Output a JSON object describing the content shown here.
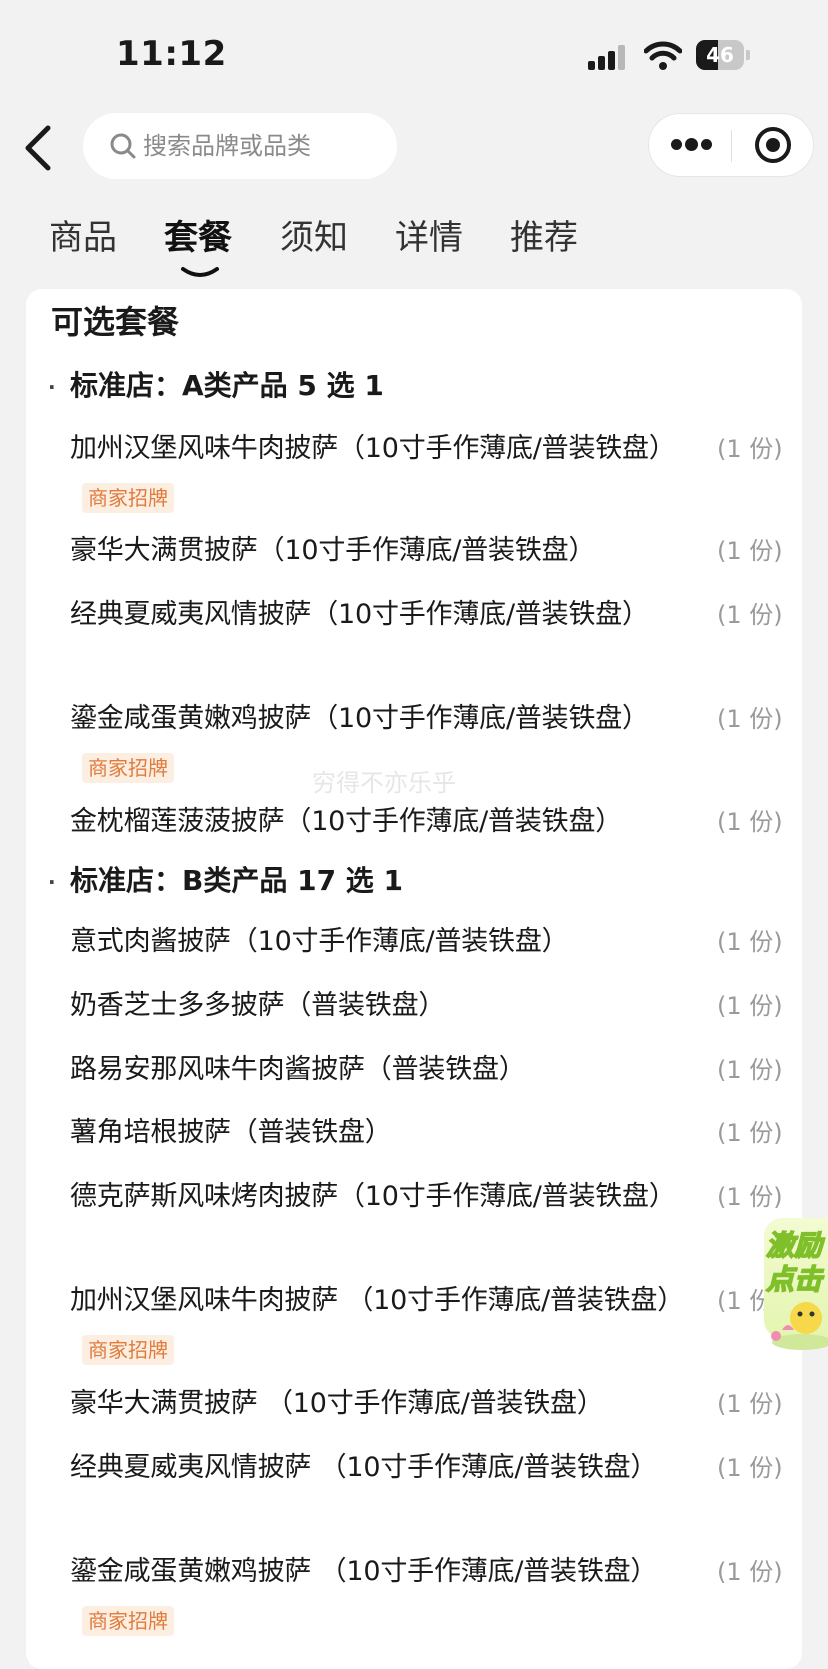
{
  "status_bar": {
    "time": "11:12",
    "battery_level": "46",
    "battery_fraction": 0.46
  },
  "search": {
    "placeholder": "搜索品牌或品类"
  },
  "tabs": [
    {
      "label": "商品",
      "active": false
    },
    {
      "label": "套餐",
      "active": true
    },
    {
      "label": "须知",
      "active": false
    },
    {
      "label": "详情",
      "active": false
    },
    {
      "label": "推荐",
      "active": false
    }
  ],
  "card": {
    "title": "可选套餐"
  },
  "groups": [
    {
      "header": "标准店：A类产品 5 选 1",
      "items": [
        {
          "name": "加州汉堡风味牛肉披萨（10寸手作薄底/普装铁盘）",
          "qty": "(1 份)",
          "tag": "商家招牌"
        },
        {
          "name": "豪华大满贯披萨（10寸手作薄底/普装铁盘）",
          "qty": "(1 份)",
          "tag": ""
        },
        {
          "name": "经典夏威夷风情披萨（10寸手作薄底/普装铁盘）",
          "qty": "(1 份)",
          "tag": ""
        },
        {
          "name": "鎏金咸蛋黄嫩鸡披萨（10寸手作薄底/普装铁盘）",
          "qty": "(1 份)",
          "tag": "商家招牌"
        },
        {
          "name": "金枕榴莲菠菠披萨（10寸手作薄底/普装铁盘）",
          "qty": "(1 份)",
          "tag": ""
        }
      ]
    },
    {
      "header": "标准店：B类产品 17 选 1",
      "items": [
        {
          "name": "意式肉酱披萨（10寸手作薄底/普装铁盘）",
          "qty": "(1 份)",
          "tag": ""
        },
        {
          "name": "奶香芝士多多披萨（普装铁盘）",
          "qty": "(1 份)",
          "tag": ""
        },
        {
          "name": "路易安那风味牛肉酱披萨（普装铁盘）",
          "qty": "(1 份)",
          "tag": ""
        },
        {
          "name": "薯角培根披萨（普装铁盘）",
          "qty": "(1 份)",
          "tag": ""
        },
        {
          "name": "德克萨斯风味烤肉披萨（10寸手作薄底/普装铁盘）",
          "qty": "(1 份)",
          "tag": ""
        },
        {
          "name": "加州汉堡风味牛肉披萨 （10寸手作薄底/普装铁盘）",
          "qty": "(1 份)",
          "tag": "商家招牌"
        },
        {
          "name": "豪华大满贯披萨 （10寸手作薄底/普装铁盘）",
          "qty": "(1 份)",
          "tag": ""
        },
        {
          "name": "经典夏威夷风情披萨 （10寸手作薄底/普装铁盘）",
          "qty": "(1 份)",
          "tag": ""
        },
        {
          "name": "鎏金咸蛋黄嫩鸡披萨 （10寸手作薄底/普装铁盘）",
          "qty": "(1 份)",
          "tag": "商家招牌"
        }
      ]
    }
  ],
  "watermark": "穷得不亦乐乎",
  "promo": {
    "line1": "激励",
    "line2": "点击"
  },
  "colors": {
    "background": "#f2f2f2",
    "card": "#ffffff",
    "tag_text": "#e07b3c",
    "tag_bg": "#fdeee2",
    "qty_text": "#9a9a9a",
    "promo_green": "#7fbf2a"
  },
  "icons": [
    "signal-icon",
    "wifi-icon",
    "battery-icon",
    "back-arrow-icon",
    "search-icon",
    "more-dots-icon",
    "target-close-icon"
  ]
}
